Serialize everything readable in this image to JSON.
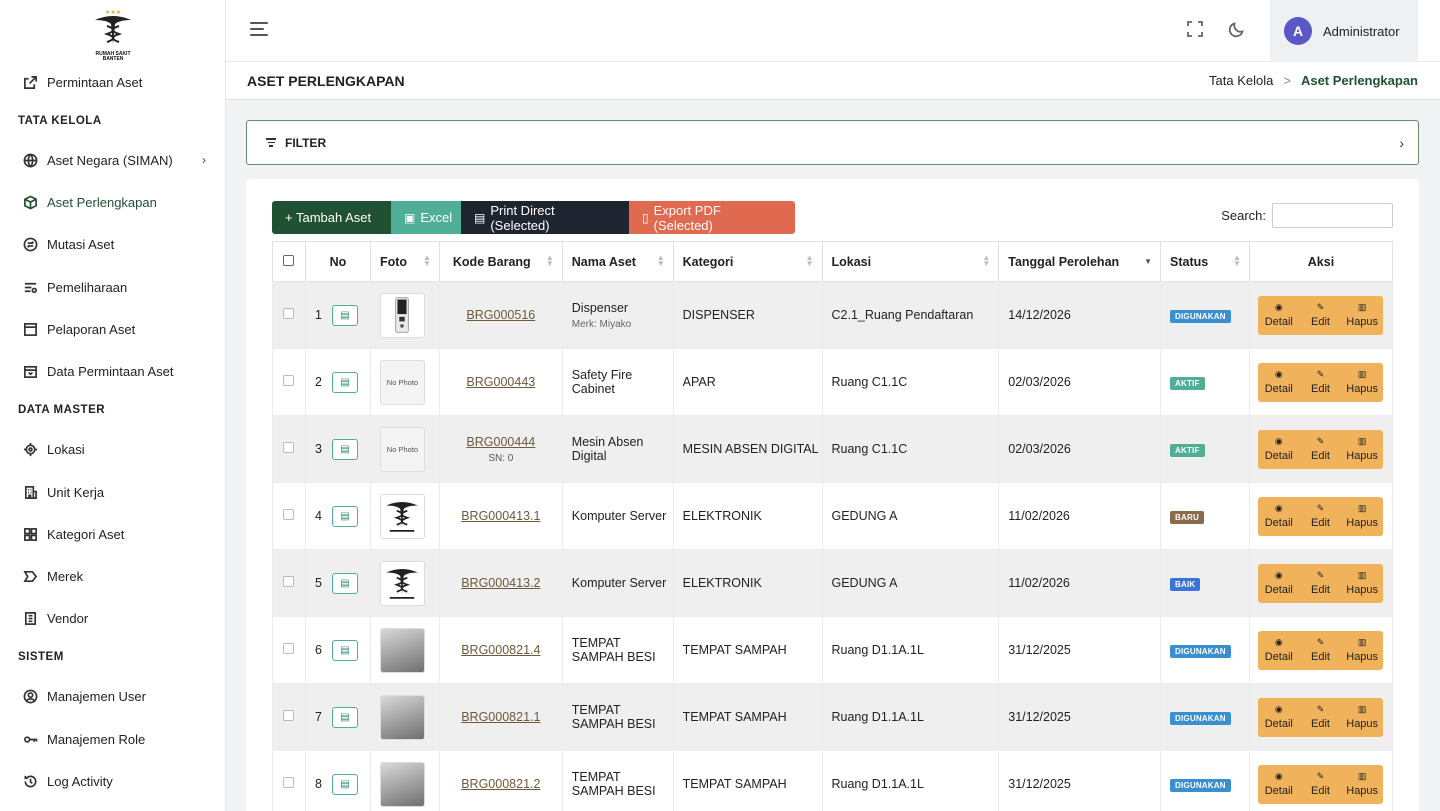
{
  "sidebar": {
    "logo_text": [
      "RUMAH SAKIT",
      "BANTEN"
    ],
    "items": [
      {
        "label": "Permintaan Aset",
        "icon": "external-link-icon"
      },
      {
        "label": "Aset Negara (SIMAN)",
        "icon": "globe-icon"
      },
      {
        "label": "Aset Perlengkapan",
        "icon": "box-icon"
      },
      {
        "label": "Mutasi Aset",
        "icon": "exchange-icon"
      },
      {
        "label": "Pemeliharaan",
        "icon": "settings-list-icon"
      },
      {
        "label": "Pelaporan Aset",
        "icon": "report-icon"
      },
      {
        "label": "Data Permintaan Aset",
        "icon": "calendar-icon"
      },
      {
        "label": "Lokasi",
        "icon": "location-icon"
      },
      {
        "label": "Unit Kerja",
        "icon": "building-icon"
      },
      {
        "label": "Kategori Aset",
        "icon": "grid-icon"
      },
      {
        "label": "Merek",
        "icon": "tag-icon"
      },
      {
        "label": "Vendor",
        "icon": "vendor-icon"
      },
      {
        "label": "Manajemen User",
        "icon": "user-circle-icon"
      },
      {
        "label": "Manajemen Role",
        "icon": "key-icon"
      },
      {
        "label": "Log Activity",
        "icon": "history-icon"
      }
    ],
    "sections": {
      "tata_kelola": "TATA KELOLA",
      "data_master": "DATA MASTER",
      "sistem": "SISTEM"
    }
  },
  "header": {
    "user_initial": "A",
    "user_name": "Administrator",
    "page_title": "ASET PERLENGKAPAN",
    "breadcrumb": {
      "parent": "Tata Kelola",
      "separator": ">",
      "current": "Aset Perlengkapan"
    }
  },
  "filter": {
    "label": "FILTER"
  },
  "toolbar": {
    "add": "+ Tambah Aset",
    "excel": "Excel",
    "print": "Print Direct (Selected)",
    "pdf": "Export PDF (Selected)",
    "search_label": "Search:"
  },
  "table": {
    "columns": [
      "No",
      "Foto",
      "Kode Barang",
      "Nama Aset",
      "Kategori",
      "Lokasi",
      "Tanggal Perolehan",
      "Status",
      "Aksi"
    ],
    "no_photo_text": "No Photo",
    "actions": {
      "detail": "Detail",
      "edit": "Edit",
      "delete": "Hapus"
    },
    "rows": [
      {
        "no": "1",
        "photo": "dispenser",
        "code": "BRG000516",
        "code_sub": "",
        "name": "Dispenser",
        "name_sub": "Merk: Miyako",
        "category": "DISPENSER",
        "location": "C2.1_Ruang Pendaftaran",
        "date": "14/12/2026",
        "status": "DIGUNAKAN",
        "status_class": "b-digunakan"
      },
      {
        "no": "2",
        "photo": "none",
        "code": "BRG000443",
        "code_sub": "",
        "name": "Safety Fire Cabinet",
        "name_sub": "",
        "category": "APAR",
        "location": "Ruang C1.1C",
        "date": "02/03/2026",
        "status": "AKTIF",
        "status_class": "b-aktif"
      },
      {
        "no": "3",
        "photo": "none",
        "code": "BRG000444",
        "code_sub": "SN: 0",
        "name": "Mesin Absen Digital",
        "name_sub": "",
        "category": "MESIN ABSEN DIGITAL",
        "location": "Ruang C1.1C",
        "date": "02/03/2026",
        "status": "AKTIF",
        "status_class": "b-aktif"
      },
      {
        "no": "4",
        "photo": "logo",
        "code": "BRG000413.1",
        "code_sub": "",
        "name": "Komputer Server",
        "name_sub": "",
        "category": "ELEKTRONIK",
        "location": "GEDUNG A",
        "date": "11/02/2026",
        "status": "BARU",
        "status_class": "b-baru"
      },
      {
        "no": "5",
        "photo": "logo",
        "code": "BRG000413.2",
        "code_sub": "",
        "name": "Komputer Server",
        "name_sub": "",
        "category": "ELEKTRONIK",
        "location": "GEDUNG A",
        "date": "11/02/2026",
        "status": "BAIK",
        "status_class": "b-baik"
      },
      {
        "no": "6",
        "photo": "bin",
        "code": "BRG000821.4",
        "code_sub": "",
        "name": "TEMPAT SAMPAH BESI",
        "name_sub": "",
        "category": "TEMPAT SAMPAH",
        "location": "Ruang D1.1A.1L",
        "date": "31/12/2025",
        "status": "DIGUNAKAN",
        "status_class": "b-digunakan"
      },
      {
        "no": "7",
        "photo": "bin",
        "code": "BRG000821.1",
        "code_sub": "",
        "name": "TEMPAT SAMPAH BESI",
        "name_sub": "",
        "category": "TEMPAT SAMPAH",
        "location": "Ruang D1.1A.1L",
        "date": "31/12/2025",
        "status": "DIGUNAKAN",
        "status_class": "b-digunakan"
      },
      {
        "no": "8",
        "photo": "bin",
        "code": "BRG000821.2",
        "code_sub": "",
        "name": "TEMPAT SAMPAH BESI",
        "name_sub": "",
        "category": "TEMPAT SAMPAH",
        "location": "Ruang D1.1A.1L",
        "date": "31/12/2025",
        "status": "DIGUNAKAN",
        "status_class": "b-digunakan"
      }
    ]
  },
  "colors": {
    "primary": "#1f5132",
    "excel": "#4fae95",
    "print": "#1f2530",
    "pdf": "#df6a4f",
    "action": "#f0b35c"
  }
}
